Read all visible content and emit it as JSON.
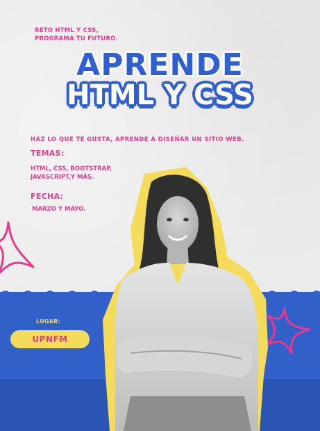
{
  "poster": {
    "top_note_line1": "RETO HTML Y CSS,",
    "top_note_line2": "PROGRAMA TU FUTURO.",
    "title_line1": "APRENDE",
    "title_line2": "HTML Y CSS",
    "tagline": "HAZ LO QUE TE GUSTA, APRENDE A DISEÑAR UN SITIO WEB.",
    "temas_heading": "TEMAS:",
    "temas_line1": "HTML, CSS, BOOTSTRAP,",
    "temas_line2": "JAVASCRIPT,Y MÁS.",
    "fecha_heading": "FECHA:",
    "fecha_value": "MARZO Y MAYO.",
    "lugar_heading": "LUGAR:",
    "lugar_value": "UPNFM"
  },
  "colors": {
    "blue": "#3060c8",
    "pink": "#e8398f",
    "yellow": "#f4dc5a",
    "background": "#ebebeb"
  },
  "icons": [
    "sparkle-star-icon"
  ]
}
